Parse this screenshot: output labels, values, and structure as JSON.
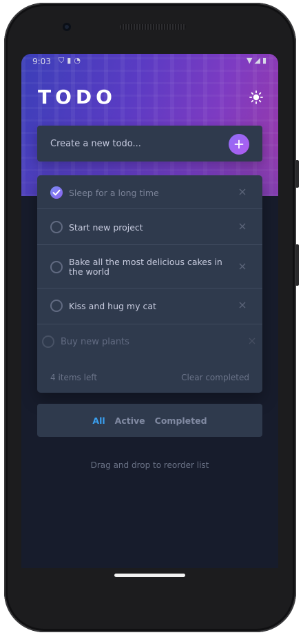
{
  "status_bar": {
    "time": "9:03",
    "left_icons": [
      "shield-icon",
      "sim-icon",
      "notification-icon"
    ],
    "right_icons": [
      "wifi-icon",
      "signal-icon",
      "battery-icon"
    ]
  },
  "header": {
    "title": "TODO",
    "theme_toggle_icon": "sun-icon"
  },
  "new_todo": {
    "placeholder": "Create a new todo...",
    "add_icon": "plus-icon"
  },
  "todos": [
    {
      "text": "Sleep for a long time",
      "completed": true
    },
    {
      "text": "Start new project",
      "completed": false
    },
    {
      "text": "Bake all the most delicious cakes in the world",
      "completed": false
    },
    {
      "text": "Kiss and hug my cat",
      "completed": false
    },
    {
      "text": "Buy new plants",
      "completed": false
    }
  ],
  "footer": {
    "items_left": "4 items left",
    "clear_completed": "Clear completed"
  },
  "filters": {
    "all": "All",
    "active": "Active",
    "completed": "Completed",
    "selected": "All"
  },
  "hint": "Drag and drop to reorder list",
  "colors": {
    "accent": "#3aa0f0",
    "check_gradient_start": "#7b8cf6",
    "check_gradient_end": "#8a63ee",
    "card": "#2f3a4d",
    "background": "#171c2c"
  }
}
